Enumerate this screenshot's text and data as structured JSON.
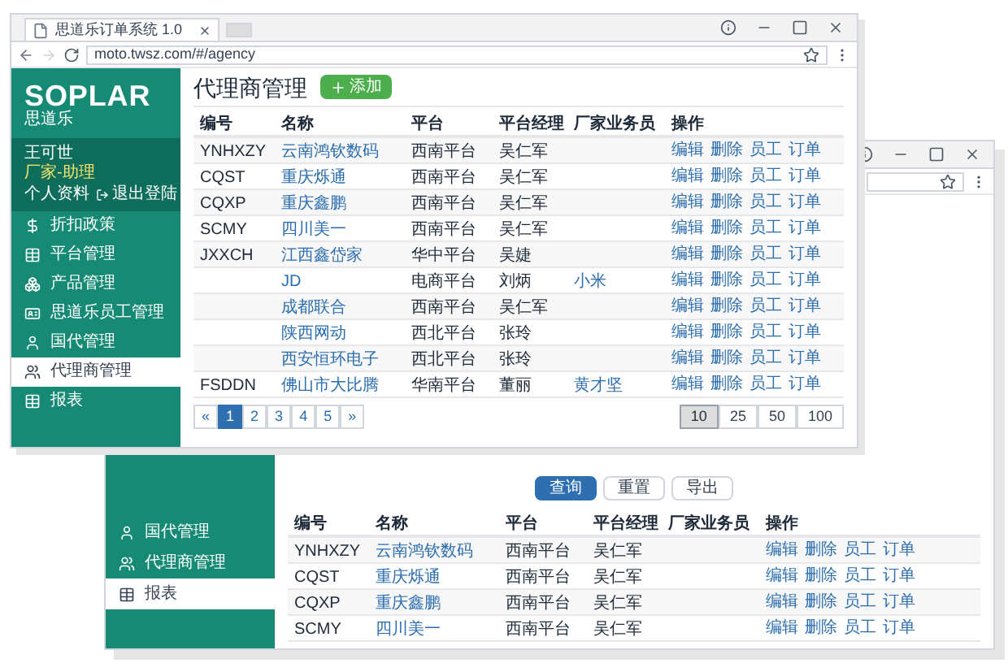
{
  "front_window": {
    "tab": {
      "title": "思道乐订单系统 1.0"
    },
    "address": "moto.twsz.com/#/agency",
    "logo": {
      "text": "SOPLAR",
      "subtitle": "思道乐"
    },
    "user": {
      "name": "王可世",
      "role": "厂家-助理",
      "links": [
        "个人资料",
        "退出登陆"
      ]
    },
    "sidebar": {
      "items": [
        {
          "label": "折扣政策",
          "selected": false
        },
        {
          "label": "平台管理",
          "selected": false
        },
        {
          "label": "产品管理",
          "selected": false
        },
        {
          "label": "思道乐员工管理",
          "selected": false
        },
        {
          "label": "国代管理",
          "selected": false
        },
        {
          "label": "代理商管理",
          "selected": true
        },
        {
          "label": "报表",
          "selected": false
        }
      ]
    },
    "page_title": "代理商管理",
    "add_button": "添加",
    "table": {
      "columns": [
        "编号",
        "名称",
        "平台",
        "平台经理",
        "厂家业务员",
        "操作"
      ],
      "rows": [
        {
          "code": "YNHXZY",
          "name": "云南鸿钦数码",
          "platform": "西南平台",
          "manager": "吴仁军",
          "actions": [
            "编辑",
            "删除",
            "员工",
            "订单"
          ]
        },
        {
          "code": "CQST",
          "name": "重庆烁通",
          "platform": "西南平台",
          "manager": "吴仁军",
          "actions": [
            "编辑",
            "删除",
            "员工",
            "订单"
          ]
        },
        {
          "code": "CQXP",
          "name": "重庆鑫鹏",
          "platform": "西南平台",
          "manager": "吴仁军",
          "actions": [
            "编辑",
            "删除",
            "员工",
            "订单"
          ]
        },
        {
          "code": "SCMY",
          "name": "四川美一",
          "platform": "西南平台",
          "manager": "吴仁军",
          "actions": [
            "编辑",
            "删除",
            "员工",
            "订单"
          ]
        },
        {
          "code": "JXXCH",
          "name": "江西鑫岱家",
          "platform": "华中平台",
          "manager": "吴婕",
          "actions": [
            "编辑",
            "删除",
            "员工",
            "订单"
          ]
        },
        {
          "name": "JD",
          "platform": "电商平台",
          "manager": "刘炳",
          "salesman": "小米",
          "actions": [
            "编辑",
            "删除",
            "员工",
            "订单"
          ]
        },
        {
          "name": "成都联合",
          "platform": "西南平台",
          "manager": "吴仁军",
          "actions": [
            "编辑",
            "删除",
            "员工",
            "订单"
          ]
        },
        {
          "name": "陕西网动",
          "platform": "西北平台",
          "manager": "张玲",
          "actions": [
            "编辑",
            "删除",
            "员工",
            "订单"
          ]
        },
        {
          "name": "西安恒环电子",
          "platform": "西北平台",
          "manager": "张玲",
          "actions": [
            "编辑",
            "删除",
            "员工",
            "订单"
          ]
        },
        {
          "code": "FSDDN",
          "name": "佛山市大比腾",
          "platform": "华南平台",
          "manager": "董丽",
          "salesman": "黄才坚",
          "actions": [
            "编辑",
            "删除",
            "员工",
            "订单"
          ]
        }
      ]
    },
    "pagination": [
      {
        "label": "«",
        "selected": false
      },
      {
        "label": "1",
        "selected": true
      },
      {
        "label": "2",
        "selected": false
      },
      {
        "label": "3",
        "selected": false
      },
      {
        "label": "4",
        "selected": false
      },
      {
        "label": "5",
        "selected": false
      },
      {
        "label": "»",
        "selected": false
      }
    ],
    "page_sizes": [
      {
        "label": "10",
        "selected": true
      },
      {
        "label": "25",
        "selected": false
      },
      {
        "label": "50",
        "selected": false
      },
      {
        "label": "100",
        "selected": false
      }
    ]
  },
  "back_window": {
    "sidebar": {
      "items": [
        {
          "label": "国代管理",
          "selected": false
        },
        {
          "label": "代理商管理",
          "selected": false
        },
        {
          "label": "报表",
          "selected": true
        }
      ]
    },
    "buttons": [
      {
        "label": "查询",
        "kind": "primary"
      },
      {
        "label": "重置",
        "kind": "default"
      },
      {
        "label": "导出",
        "kind": "default"
      }
    ],
    "table": {
      "columns": [
        "编号",
        "名称",
        "平台",
        "平台经理",
        "厂家业务员",
        "操作"
      ],
      "rows": [
        {
          "code": "YNHXZY",
          "name": "云南鸿钦数码",
          "platform": "西南平台",
          "manager": "吴仁军",
          "actions": [
            "编辑",
            "删除",
            "员工",
            "订单"
          ]
        },
        {
          "code": "CQST",
          "name": "重庆烁通",
          "platform": "西南平台",
          "manager": "吴仁军",
          "actions": [
            "编辑",
            "删除",
            "员工",
            "订单"
          ]
        },
        {
          "code": "CQXP",
          "name": "重庆鑫鹏",
          "platform": "西南平台",
          "manager": "吴仁军",
          "actions": [
            "编辑",
            "删除",
            "员工",
            "订单"
          ]
        },
        {
          "code": "SCMY",
          "name": "四川美一",
          "platform": "西南平台",
          "manager": "吴仁军",
          "actions": [
            "编辑",
            "删除",
            "员工",
            "订单"
          ]
        }
      ]
    }
  }
}
